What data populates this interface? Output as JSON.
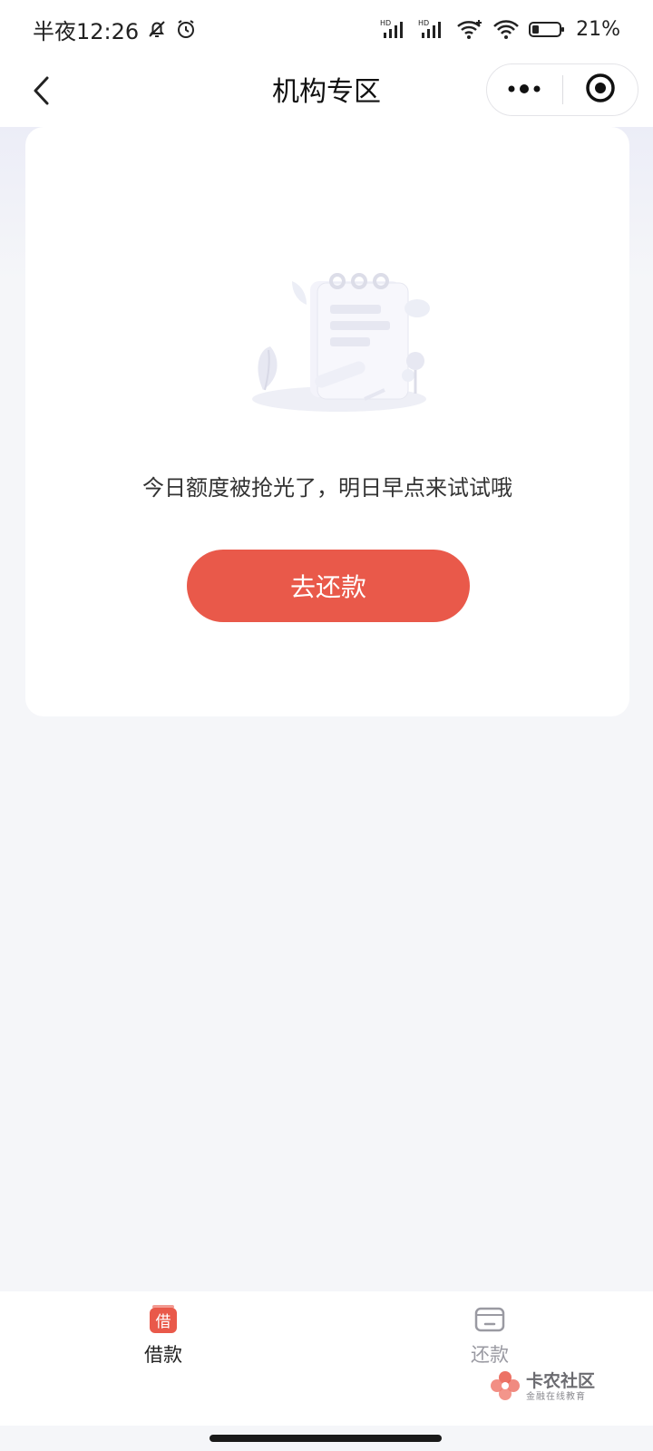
{
  "status_bar": {
    "time": "半夜12:26",
    "battery": "21%",
    "icons": [
      "bell-off-icon",
      "alarm-icon",
      "signal-hd-icon",
      "signal-hd-icon",
      "wifi-icon",
      "wifi-icon",
      "battery-icon"
    ]
  },
  "nav": {
    "title": "机构专区",
    "back_icon": "chevron-left-icon",
    "more_icon": "more-dots-icon",
    "close_icon": "target-icon"
  },
  "main": {
    "empty_message": "今日额度被抢光了，明日早点来试试哦",
    "repay_button": "去还款",
    "illustration": "empty-notebook-illustration"
  },
  "tabs": [
    {
      "label": "借款",
      "icon": "borrow-icon",
      "icon_text": "借",
      "active": true
    },
    {
      "label": "还款",
      "icon": "repay-card-icon",
      "active": false
    }
  ],
  "watermark": {
    "title": "卡农社区",
    "subtitle": "金融在线教育"
  },
  "colors": {
    "accent": "#e9594a",
    "background": "#f5f6f9"
  }
}
